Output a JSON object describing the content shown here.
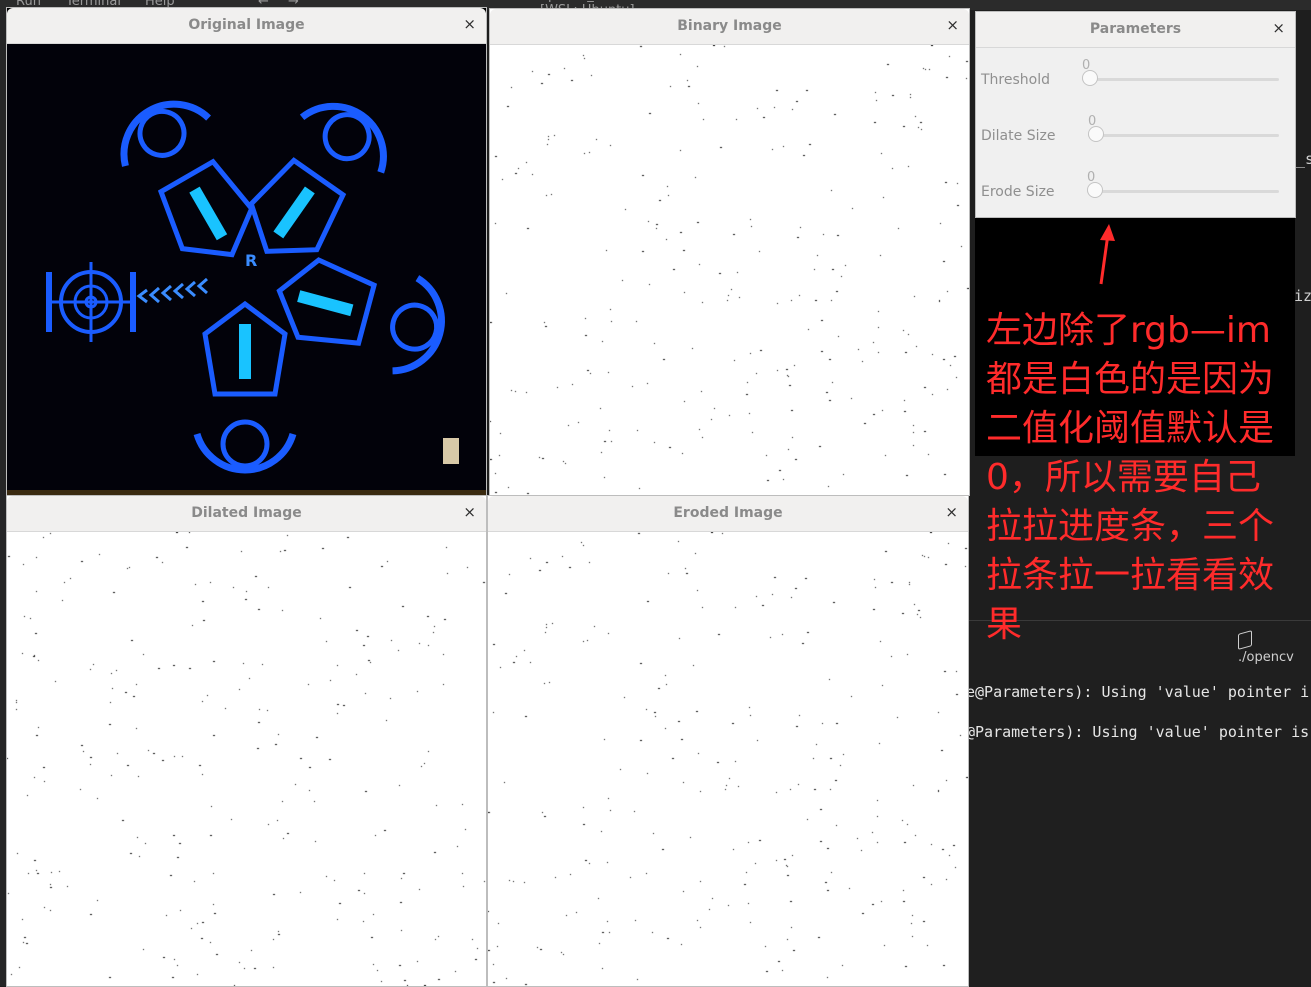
{
  "ide": {
    "menu": [
      "Run",
      "Terminal",
      "Help"
    ],
    "search_title": "opencv_test [WSL: Ubuntu] [Administrator]",
    "panel_tab": "./opencv",
    "terminal_lines": [
      "e@Parameters): Using 'value' pointer i",
      "@Parameters): Using 'value' pointer is"
    ]
  },
  "windows": {
    "original": {
      "title": "Original Image",
      "close": "×"
    },
    "binary": {
      "title": "Binary Image",
      "close": "×"
    },
    "dilated": {
      "title": "Dilated Image",
      "close": "×"
    },
    "eroded": {
      "title": "Eroded Image",
      "close": "×"
    },
    "parameters": {
      "title": "Parameters",
      "close": "×"
    }
  },
  "parameters": [
    {
      "label": "Threshold",
      "value": "0",
      "level": 0
    },
    {
      "label": "Dilate Size",
      "value": "0",
      "level": 0
    },
    {
      "label": "Erode Size",
      "value": "0",
      "level": 0
    }
  ],
  "annotation": {
    "text": "左边除了rgb—im都是白色的是因为二值化阈值默认是0，所以需要自己拉拉进度条，三个拉条拉一拉看看效果",
    "color": "#ff2b2b"
  },
  "colors": {
    "neon_blue": "#1a5cff",
    "neon_cyan": "#19c3ff"
  }
}
